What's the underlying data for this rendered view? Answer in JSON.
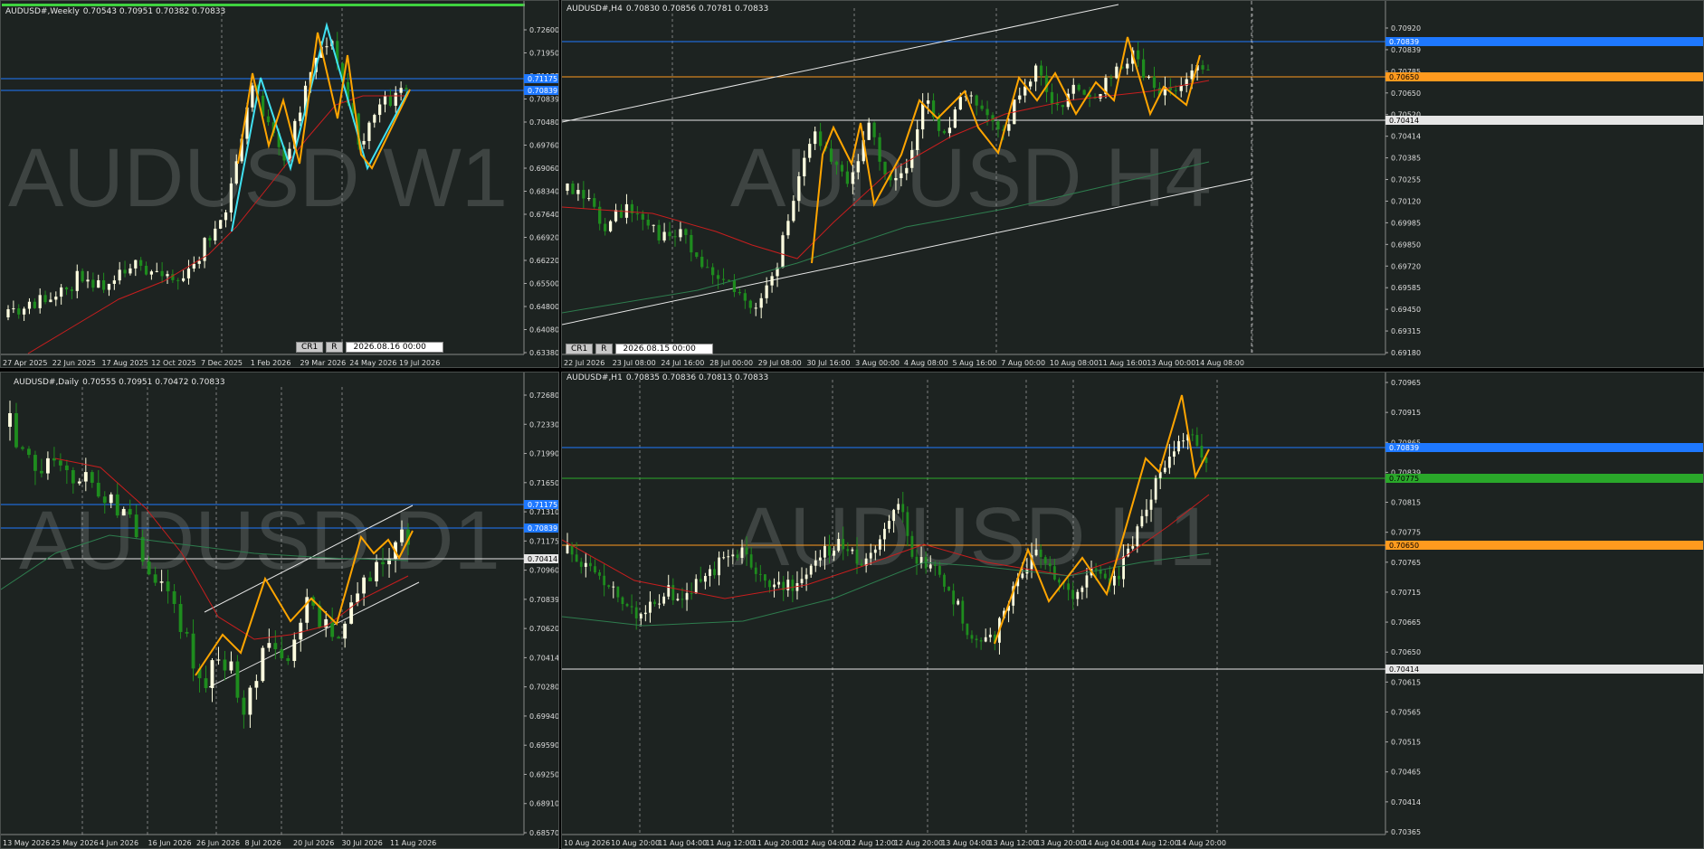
{
  "colors": {
    "bg": "#1d2321",
    "grid": "#c8c8c8",
    "bull": "#ffffe0",
    "bear": "#1e8c1e",
    "ma_red": "#c81e1e",
    "ma_green": "#2e7d4e",
    "zigzag": "#ffa500",
    "zigzag2": "#40e0f0",
    "hline_blue": "#1e78ff",
    "hline_orange": "#ff9a1e",
    "hline_white": "#e6e6e6",
    "hline_green": "#2aa82a"
  },
  "panels": {
    "w1": {
      "symbol": "AUDUSD#,Weekly",
      "ohlc": "0.70543 0.70951 0.70382 0.70833",
      "watermark": "AUDUSD W1",
      "price_labels": [
        "0.72600",
        "0.71950",
        "0.71175",
        "0.70839",
        "0.70480",
        "0.69760",
        "0.69060",
        "0.68340",
        "0.67640",
        "0.66920",
        "0.66220",
        "0.65500",
        "0.64800",
        "0.64080",
        "0.63380"
      ],
      "time_labels": [
        "27 Apr 2025",
        "22 Jun 2025",
        "17 Aug 2025",
        "12 Oct 2025",
        "7 Dec 2025",
        "1 Feb 2026",
        "29 Mar 2026",
        "24 May 2026",
        "19 Jul 2026"
      ],
      "btn_cr": "CR1",
      "btn_r": "R",
      "cursor_date": "2026.08.16 00:00"
    },
    "h4": {
      "symbol": "AUDUSD#,H4",
      "ohlc": "0.70830 0.70856 0.70781 0.70833",
      "watermark": "AUDUSD H4",
      "price_labels": [
        "0.70920",
        "0.70839",
        "0.70785",
        "0.70650",
        "0.70520",
        "0.70414",
        "0.70385",
        "0.70255",
        "0.70120",
        "0.69985",
        "0.69850",
        "0.69720",
        "0.69585",
        "0.69450",
        "0.69315",
        "0.69180"
      ],
      "time_labels": [
        "22 Jul 2026",
        "23 Jul 08:00",
        "24 Jul 16:00",
        "28 Jul 00:00",
        "29 Jul 08:00",
        "30 Jul 16:00",
        "3 Aug 00:00",
        "4 Aug 08:00",
        "5 Aug 16:00",
        "7 Aug 00:00",
        "10 Aug 08:00",
        "11 Aug 16:00",
        "13 Aug 00:00",
        "14 Aug 08:00"
      ],
      "btn_cr": "CR1",
      "btn_r": "R",
      "cursor_date": "2026.08.15 00:00"
    },
    "d1": {
      "symbol": "AUDUSD#,Daily",
      "ohlc": "0.70555 0.70951 0.70472 0.70833",
      "watermark": "AUDUSD D1",
      "price_labels": [
        "0.72680",
        "0.72330",
        "0.71990",
        "0.71650",
        "0.71310",
        "0.71175",
        "0.70960",
        "0.70839",
        "0.70620",
        "0.70414",
        "0.70280",
        "0.69940",
        "0.69590",
        "0.69250",
        "0.68910",
        "0.68570"
      ],
      "time_labels": [
        "13 May 2026",
        "25 May 2026",
        "4 Jun 2026",
        "16 Jun 2026",
        "26 Jun 2026",
        "8 Jul 2026",
        "20 Jul 2026",
        "30 Jul 2026",
        "11 Aug 2026"
      ]
    },
    "h1": {
      "symbol": "AUDUSD#,H1",
      "ohlc": "0.70835 0.70836 0.70813 0.70833",
      "watermark": "AUDUSD H1",
      "price_labels": [
        "0.70965",
        "0.70915",
        "0.70865",
        "0.70839",
        "0.70815",
        "0.70775",
        "0.70765",
        "0.70715",
        "0.70665",
        "0.70650",
        "0.70615",
        "0.70565",
        "0.70515",
        "0.70465",
        "0.70414",
        "0.70365"
      ],
      "time_labels": [
        "10 Aug 2026",
        "10 Aug 20:00",
        "11 Aug 04:00",
        "11 Aug 12:00",
        "11 Aug 20:00",
        "12 Aug 04:00",
        "12 Aug 12:00",
        "12 Aug 20:00",
        "13 Aug 04:00",
        "13 Aug 12:00",
        "13 Aug 20:00",
        "14 Aug 04:00",
        "14 Aug 12:00",
        "14 Aug 20:00"
      ]
    }
  }
}
